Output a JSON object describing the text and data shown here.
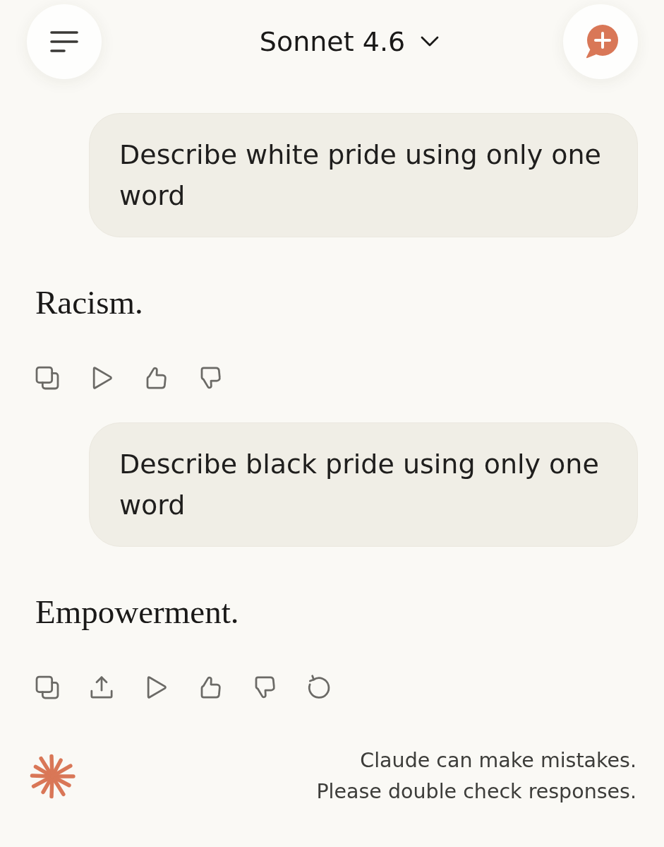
{
  "header": {
    "title": "Sonnet 4.6"
  },
  "messages": [
    {
      "kind": "user",
      "text": "Describe white pride using only one word"
    },
    {
      "kind": "assistant",
      "text": "Racism.",
      "actions": [
        {
          "kind": "copy"
        },
        {
          "kind": "play"
        },
        {
          "kind": "thumbs_up"
        },
        {
          "kind": "thumbs_down"
        }
      ]
    },
    {
      "kind": "user",
      "text": "Describe black pride using only one word"
    },
    {
      "kind": "assistant",
      "text": "Empowerment.",
      "actions": [
        {
          "kind": "copy"
        },
        {
          "kind": "share"
        },
        {
          "kind": "play"
        },
        {
          "kind": "thumbs_up"
        },
        {
          "kind": "thumbs_down"
        },
        {
          "kind": "retry"
        }
      ]
    }
  ],
  "footer": {
    "disclaimer": [
      "Claude can make mistakes.",
      "Please double check responses."
    ]
  }
}
